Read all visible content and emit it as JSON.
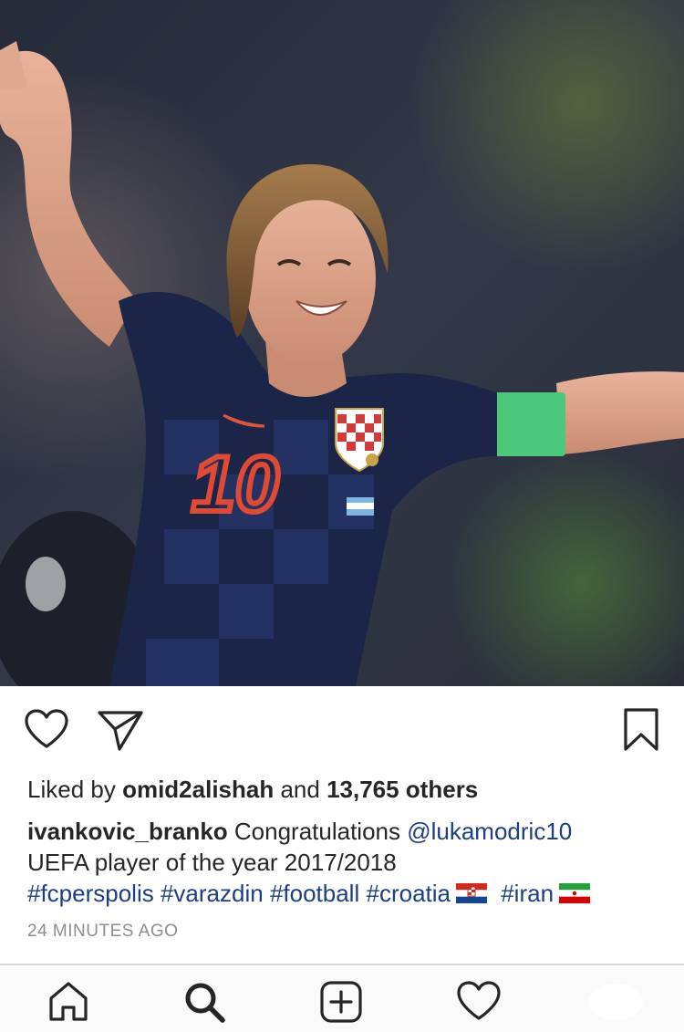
{
  "post": {
    "image_alt": "Football player in checkered navy jersey number 10 celebrating with arms outstretched",
    "jersey_number": "10",
    "likes": {
      "prefix": "Liked by ",
      "user": "omid2alishah",
      "middle": " and ",
      "count": "13,765 others"
    },
    "caption": {
      "username": "ivankovic_branko",
      "text": " Congratulations ",
      "mention": "@lukamodric10",
      "line2": "UEFA player of the year 2017/2018",
      "hashtags": [
        "#fcperspolis",
        "#varazdin",
        "#football",
        "#croatia",
        "#iran"
      ]
    },
    "timestamp": "24 MINUTES AGO"
  },
  "icons": {
    "like": "heart-icon",
    "share": "paper-plane-icon",
    "save": "bookmark-icon",
    "home": "home-icon",
    "search": "search-icon",
    "add": "plus-square-icon",
    "activity": "heart-icon"
  },
  "colors": {
    "link": "#1b3f85",
    "text": "#262626",
    "meta": "#8e8e8e",
    "armband": "#4cc87a"
  }
}
